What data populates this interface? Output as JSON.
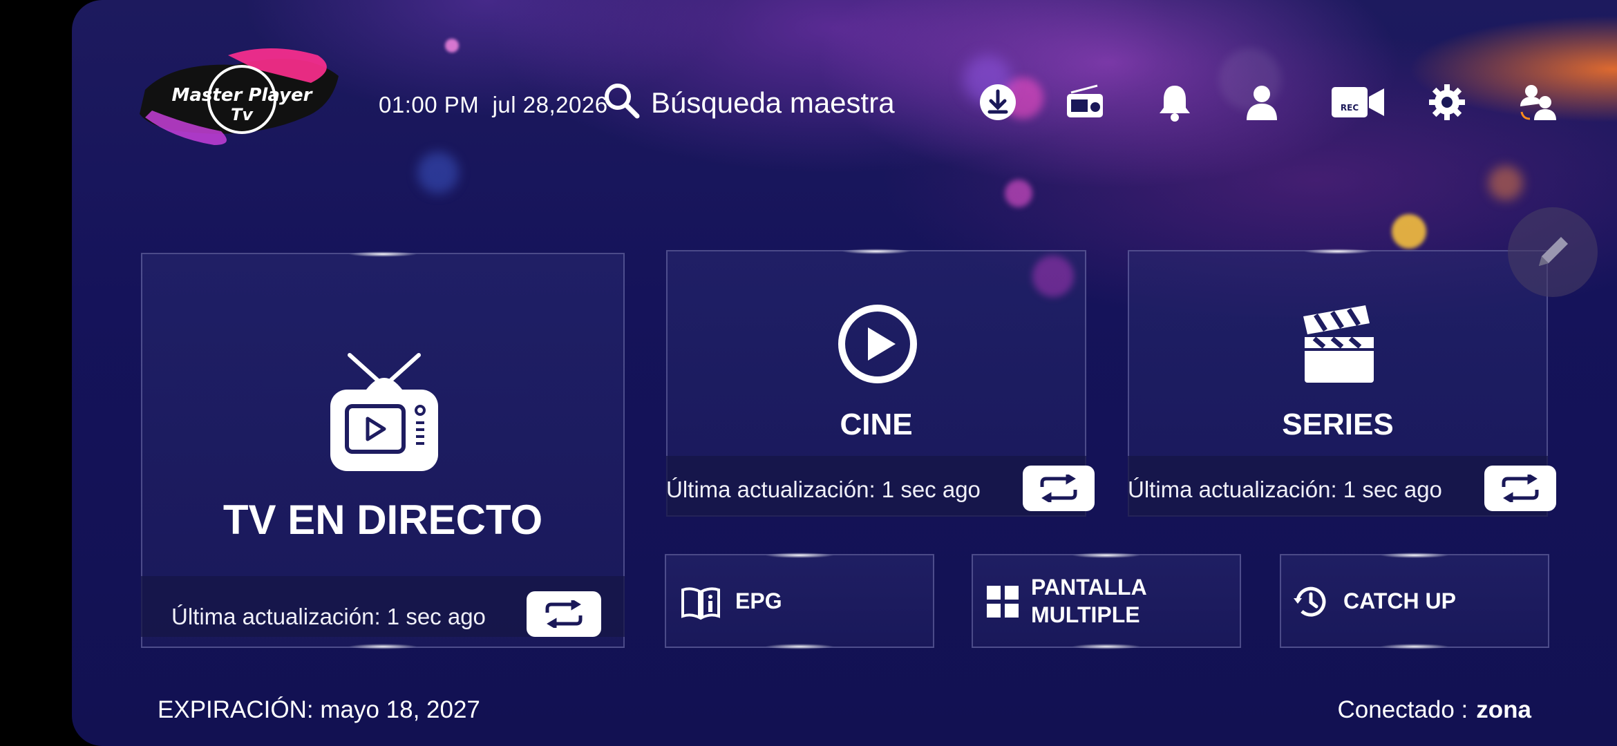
{
  "header": {
    "logo_text_line1": "Master Player",
    "logo_text_line2": "Tv",
    "time": "01:00 PM",
    "date": "jul 28,2026",
    "search_label": "Búsqueda maestra",
    "icons": [
      "download-icon",
      "radio-icon",
      "bell-icon",
      "user-icon",
      "rec-camera-icon",
      "gear-icon",
      "switch-user-icon"
    ],
    "rec_text": "REC"
  },
  "cards": {
    "live": {
      "title": "TV EN DIRECTO",
      "update": "Última actualización: 1 sec ago"
    },
    "cine": {
      "title": "CINE",
      "update": "Última actualización: 1 sec ago"
    },
    "series": {
      "title": "SERIES",
      "update": "Última actualización: 1 sec ago"
    }
  },
  "small_cards": {
    "epg": "EPG",
    "multi_line1": "PANTALLA",
    "multi_line2": "MULTIPLE",
    "catchup": "CATCH UP"
  },
  "footer": {
    "expiration": "EXPIRACIÓN: mayo 18, 2027",
    "connected_label": "Conectado :",
    "connected_value": "zona"
  },
  "colors": {
    "background": "#15135a",
    "card_border": "#aaaadc",
    "accent_pink": "#ff3fa0"
  }
}
